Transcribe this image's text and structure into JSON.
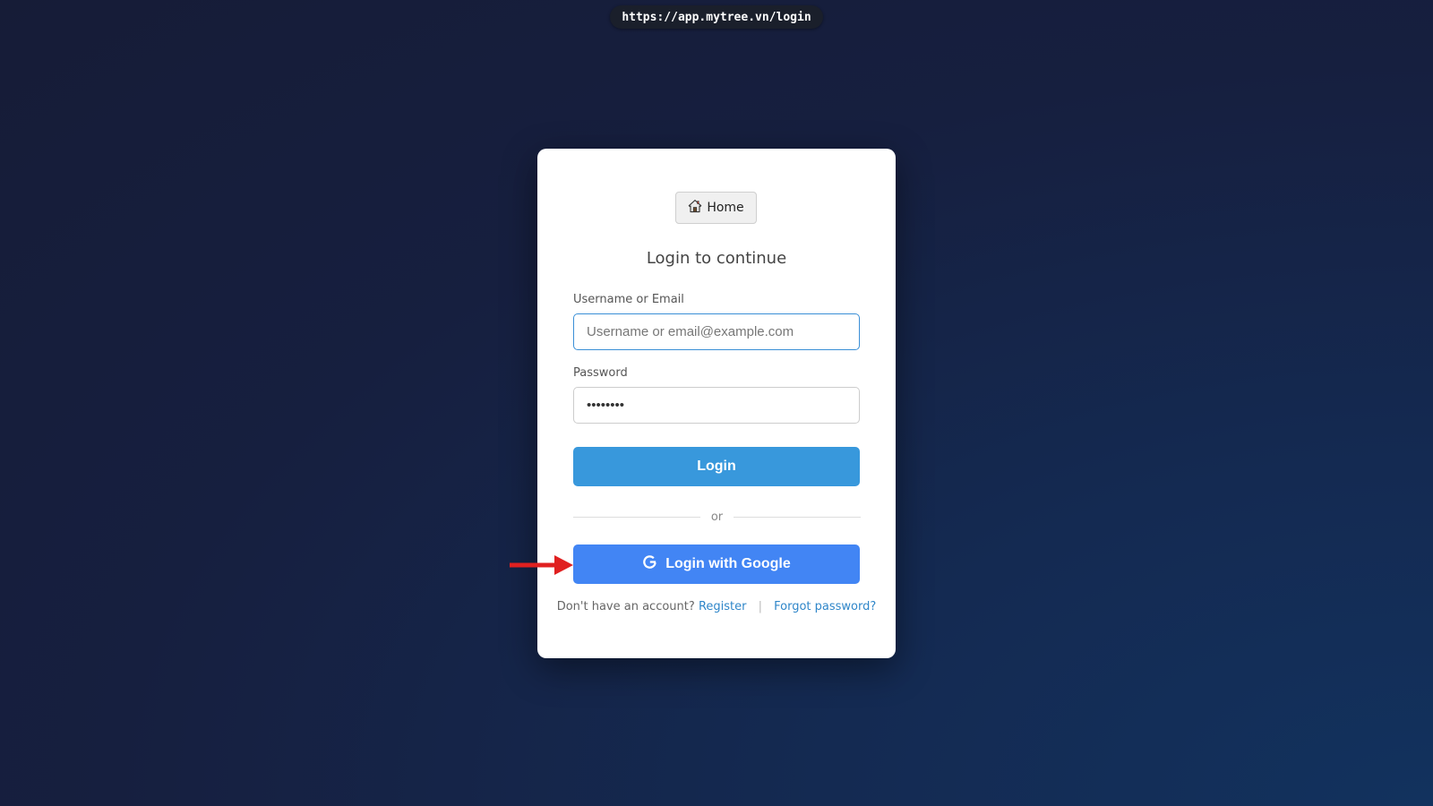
{
  "browser": {
    "url": "https://app.mytree.vn/login"
  },
  "login_card": {
    "home_button_label": "Home",
    "title": "Login to continue",
    "username": {
      "label": "Username or Email",
      "placeholder": "Username or email@example.com",
      "value": ""
    },
    "password": {
      "label": "Password",
      "value": "12345678"
    },
    "login_button_label": "Login",
    "divider_text": "or",
    "google_button_label": "Login with Google",
    "footer": {
      "prompt": "Don't have an account?",
      "register_link": "Register",
      "separator": "|",
      "forgot_link": "Forgot password?"
    }
  },
  "icons": {
    "home": "home-icon",
    "google": "google-g-icon",
    "annotation": "red-arrow-icon"
  },
  "colors": {
    "login_button": "#3898dc",
    "google_button": "#4285f4",
    "link": "#2f86c9",
    "focus_border": "#3a8fd6",
    "annotation_arrow": "#e02020"
  }
}
